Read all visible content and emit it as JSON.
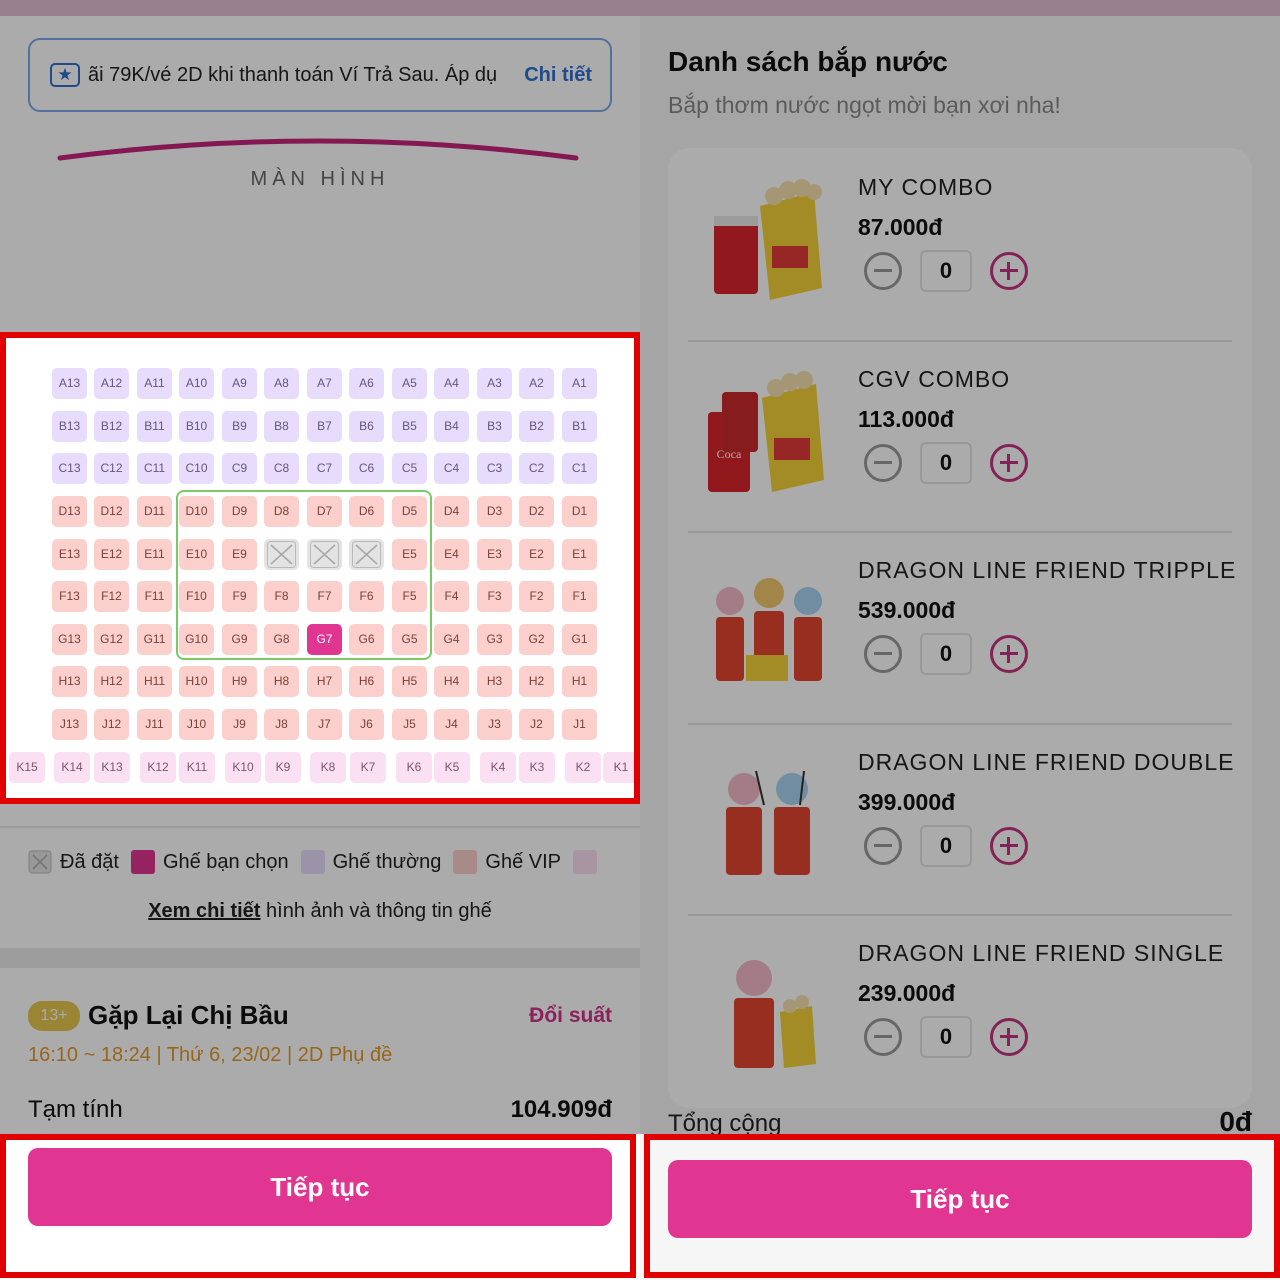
{
  "left": {
    "promo": {
      "icon": "ticket-star-icon",
      "text": "ãi 79K/vé 2D khi thanh toán Ví Trả Sau. Áp dụ",
      "link": "Chi tiết"
    },
    "screen_label": "MÀN HÌNH",
    "seat_rows": [
      {
        "row": "A",
        "type": "normal"
      },
      {
        "row": "B",
        "type": "normal"
      },
      {
        "row": "C",
        "type": "normal"
      },
      {
        "row": "D",
        "type": "vip"
      },
      {
        "row": "E",
        "type": "vip"
      },
      {
        "row": "F",
        "type": "vip"
      },
      {
        "row": "G",
        "type": "vip"
      },
      {
        "row": "H",
        "type": "vip"
      },
      {
        "row": "J",
        "type": "vip"
      }
    ],
    "seat_numbers": [
      13,
      12,
      11,
      10,
      9,
      8,
      7,
      6,
      5,
      4,
      3,
      2,
      1
    ],
    "couple_row": [
      "K15",
      "K14",
      "K13",
      "K12",
      "K11",
      "K10",
      "K9",
      "K8",
      "K7",
      "K6",
      "K5",
      "K4",
      "K3",
      "K2",
      "K1"
    ],
    "booked_seats": [
      "E8",
      "E7",
      "E6"
    ],
    "selected_seats": [
      "G7"
    ],
    "legend": {
      "booked": "Đã đặt",
      "selected": "Ghế bạn chọn",
      "normal": "Ghế thường",
      "vip": "Ghế VIP"
    },
    "detail_link": "Xem chi tiết",
    "detail_rest": " hình ảnh và thông tin ghế",
    "movie": {
      "age": "13+",
      "title": "Gặp Lại Chị Bầu",
      "change": "Đổi suất",
      "showtime": "16:10 ~ 18:24 | Thứ 6, 23/02 | 2D Phụ đề"
    },
    "subtotal_label": "Tạm tính",
    "subtotal_value": "104.909đ",
    "continue": "Tiếp tục"
  },
  "right": {
    "title": "Danh sách bắp nước",
    "subtitle": "Bắp thơm nước ngọt mời bạn xơi nha!",
    "combos": [
      {
        "name": "MY COMBO",
        "price": "87.000đ",
        "qty": "0",
        "image": "popcorn-cup-combo-image"
      },
      {
        "name": "CGV COMBO",
        "price": "113.000đ",
        "qty": "0",
        "image": "popcorn-coke-combo-image"
      },
      {
        "name": "DRAGON LINE FRIEND TRIPPLE",
        "price": "539.000đ",
        "qty": "0",
        "image": "dragon-triple-cups-image"
      },
      {
        "name": "DRAGON LINE FRIEND DOUBLE",
        "price": "399.000đ",
        "qty": "0",
        "image": "dragon-double-cups-image"
      },
      {
        "name": "DRAGON LINE FRIEND SINGLE",
        "price": "239.000đ",
        "qty": "0",
        "image": "dragon-single-cup-image"
      }
    ],
    "total_label": "Tổng cộng",
    "total_value": "0đ",
    "continue": "Tiếp tục"
  },
  "colors": {
    "accent": "#e03590",
    "normal_seat": "#e7dcfb",
    "vip_seat": "#fbd0cc",
    "couple_seat": "#fbdff2",
    "selected_seat": "#e03591",
    "booked_seat": "#e3e3e3",
    "highlight": "#7cc766",
    "annotation": "#e00000"
  }
}
